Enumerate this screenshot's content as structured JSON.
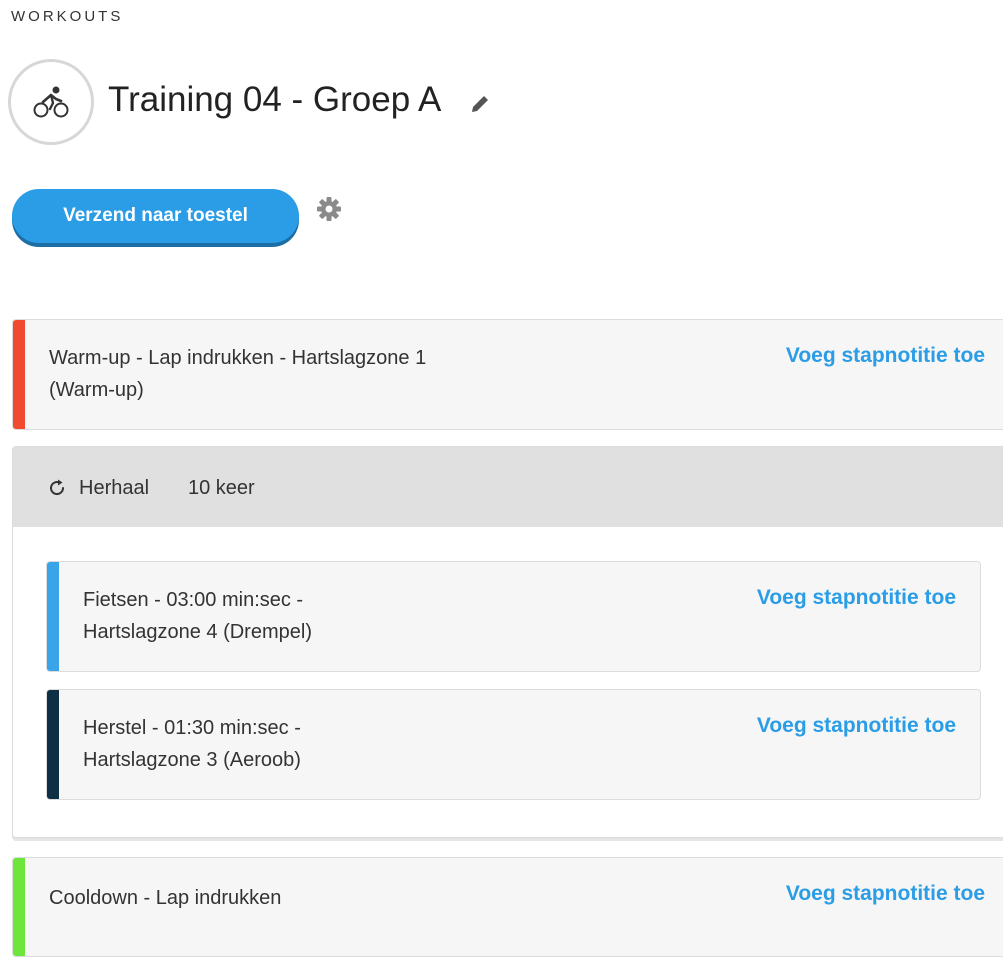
{
  "header": {
    "section_label": "WORKOUTS",
    "title": "Training 04 - Groep A",
    "sport_icon": "bike-icon",
    "edit_icon": "pencil-icon"
  },
  "actions": {
    "send_label": "Verzend naar toestel",
    "settings_icon": "gear-icon"
  },
  "colors": {
    "accent": "#2a9de6",
    "warmup": "#f04a30",
    "bike": "#3aa4e8",
    "rest": "#0e2f44",
    "cooldown": "#6ee53a"
  },
  "steps": {
    "warmup": {
      "line1": "Warm-up - Lap indrukken - Hartslagzone 1",
      "line2": "(Warm-up)",
      "note_link": "Voeg stapnotitie toe"
    },
    "repeat": {
      "label": "Herhaal",
      "count": "10 keer",
      "icon": "repeat-icon",
      "items": [
        {
          "line1": "Fietsen - 03:00 min:sec -",
          "line2": "Hartslagzone 4 (Drempel)",
          "note_link": "Voeg stapnotitie toe"
        },
        {
          "line1": "Herstel - 01:30 min:sec -",
          "line2": "Hartslagzone 3 (Aeroob)",
          "note_link": "Voeg stapnotitie toe"
        }
      ]
    },
    "cooldown": {
      "line1": "Cooldown - Lap indrukken",
      "note_link": "Voeg stapnotitie toe"
    }
  }
}
